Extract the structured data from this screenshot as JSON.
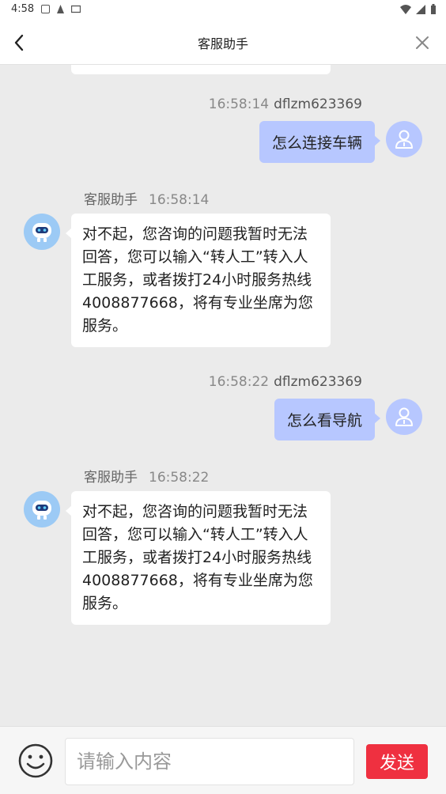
{
  "status_bar": {
    "time": "4:58"
  },
  "header": {
    "title": "客服助手"
  },
  "messages": [
    {
      "sender": "user",
      "time": "16:58:14",
      "username": "dflzm623369",
      "text": "怎么连接车辆"
    },
    {
      "sender": "bot",
      "name": "客服助手",
      "time": "16:58:14",
      "text": "对不起，您咨询的问题我暂时无法回答，您可以输入“转人工”转入人工服务，或者拨打24小时服务热线4008877668，将有专业坐席为您服务。"
    },
    {
      "sender": "user",
      "time": "16:58:22",
      "username": "dflzm623369",
      "text": "怎么看导航"
    },
    {
      "sender": "bot",
      "name": "客服助手",
      "time": "16:58:22",
      "text": "对不起，您咨询的问题我暂时无法回答，您可以输入“转人工”转入人工服务，或者拨打24小时服务热线4008877668，将有专业坐席为您服务。"
    }
  ],
  "input": {
    "placeholder": "请输入内容",
    "value": ""
  },
  "send_label": "发送",
  "colors": {
    "accent_send": "#ef3040",
    "user_bubble": "#b7c7ff",
    "bot_avatar": "#9ccaf5"
  }
}
